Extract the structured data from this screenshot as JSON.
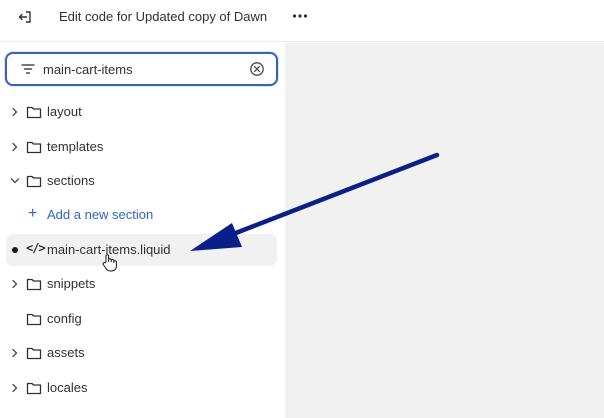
{
  "header": {
    "title": "Edit code for Updated copy of Dawn",
    "exit_icon": "exit-icon",
    "more_icon": "more-horizontal-icon"
  },
  "search": {
    "value": "main-cart-items",
    "filter_icon": "filter-icon",
    "clear_icon": "clear-circle-icon"
  },
  "tree": {
    "items": [
      {
        "label": "layout",
        "kind": "folder",
        "expanded": false
      },
      {
        "label": "templates",
        "kind": "folder",
        "expanded": false
      },
      {
        "label": "sections",
        "kind": "folder",
        "expanded": true
      },
      {
        "label": "Add a new section",
        "kind": "add-link"
      },
      {
        "label": "main-cart-items.liquid",
        "kind": "file",
        "modified": true
      },
      {
        "label": "snippets",
        "kind": "folder",
        "expanded": false
      },
      {
        "label": "config",
        "kind": "folder",
        "expanded": false
      },
      {
        "label": "assets",
        "kind": "folder",
        "expanded": false
      },
      {
        "label": "locales",
        "kind": "folder",
        "expanded": false
      }
    ]
  },
  "colors": {
    "accent": "#2e65c6",
    "focus_border": "#3a5fc1",
    "annotation_arrow": "#0b1f8a",
    "editor_background": "#f1f1f1"
  }
}
